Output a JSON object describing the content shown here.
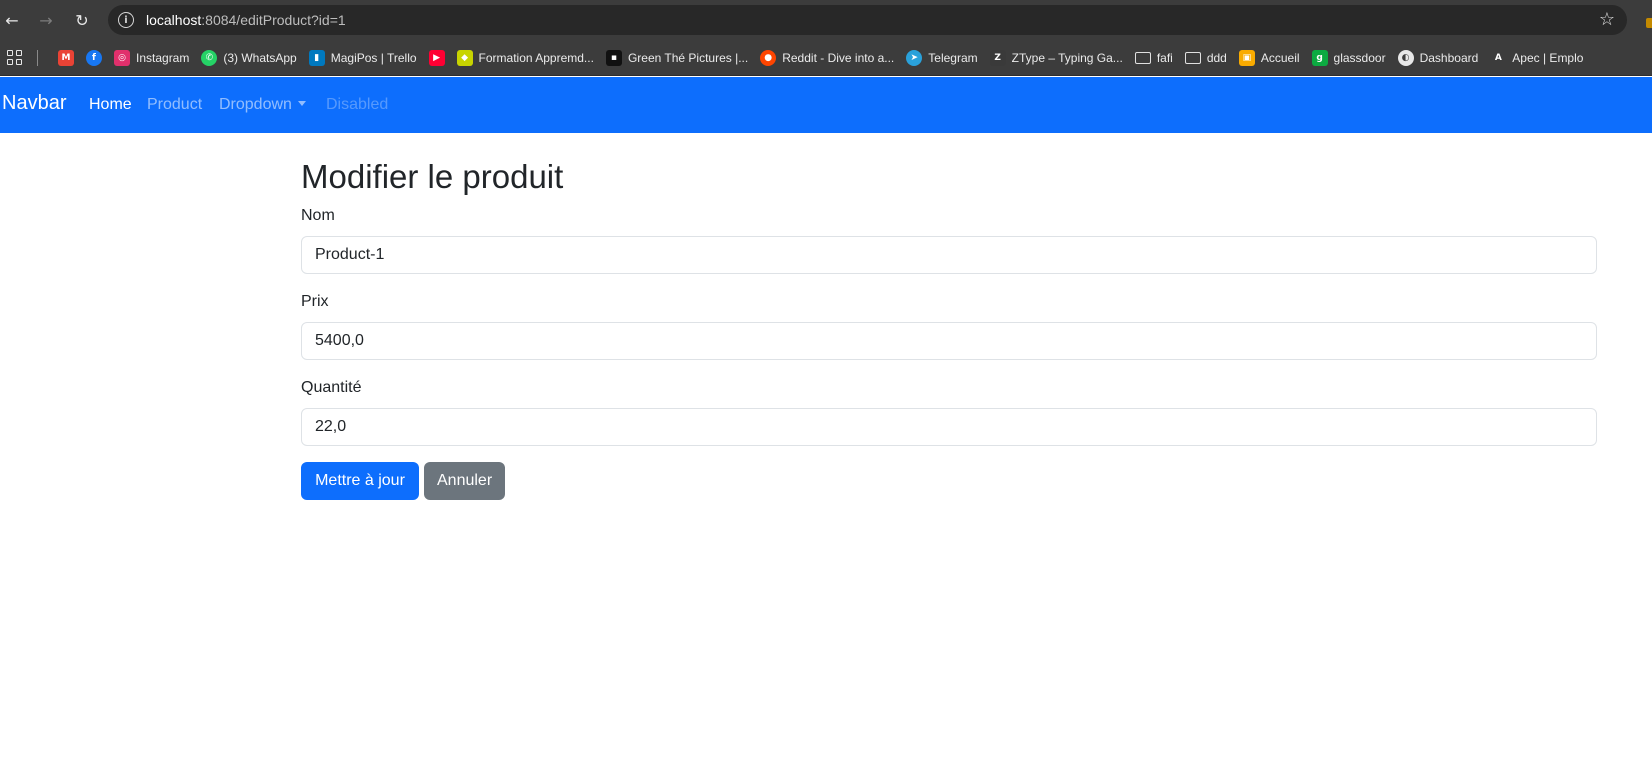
{
  "browser": {
    "url_host": "localhost",
    "url_rest": ":8084/editProduct?id=1",
    "bookmarks": [
      {
        "label": "",
        "icon": "gmail-icon",
        "color": "#ea4335"
      },
      {
        "label": "",
        "icon": "facebook-icon",
        "color": "#1877f2"
      },
      {
        "label": "Instagram",
        "icon": "instagram-icon",
        "color": "#e1306c"
      },
      {
        "label": "(3) WhatsApp",
        "icon": "whatsapp-icon",
        "color": "#25d366"
      },
      {
        "label": "MagiPos | Trello",
        "icon": "trello-icon",
        "color": "#0079bf"
      },
      {
        "label": "",
        "icon": "youtube-icon",
        "color": "#ff0033"
      },
      {
        "label": "Formation Appremd...",
        "icon": "shield-icon",
        "color": "#c8d400"
      },
      {
        "label": "Green Thé Pictures |...",
        "icon": "unsplash-icon",
        "color": "#111111"
      },
      {
        "label": "Reddit - Dive into a...",
        "icon": "reddit-icon",
        "color": "#ff4500"
      },
      {
        "label": "Telegram",
        "icon": "telegram-icon",
        "color": "#2aa1da"
      },
      {
        "label": "ZType – Typing Ga...",
        "icon": "ztype-icon",
        "color": "#3a3a3a"
      },
      {
        "label": "fafi",
        "icon": "folder-icon",
        "color": ""
      },
      {
        "label": "ddd",
        "icon": "folder-icon",
        "color": ""
      },
      {
        "label": "Accueil",
        "icon": "classroom-icon",
        "color": "#f9ab00"
      },
      {
        "label": "glassdoor",
        "icon": "glassdoor-icon",
        "color": "#0caa41"
      },
      {
        "label": "Dashboard",
        "icon": "dashboard-icon",
        "color": "#e8e8e8"
      },
      {
        "label": "Apec | Emplo",
        "icon": "apec-icon",
        "color": "#3c3c3c"
      }
    ]
  },
  "navbar": {
    "brand": "Navbar",
    "links": {
      "home": "Home",
      "product": "Product",
      "dropdown": "Dropdown",
      "disabled": "Disabled"
    },
    "color": "#0d6efd"
  },
  "form": {
    "title": "Modifier le produit",
    "fields": {
      "nom_label": "Nom",
      "nom_value": "Product-1",
      "prix_label": "Prix",
      "prix_value": "5400,0",
      "quantite_label": "Quantité",
      "quantite_value": "22,0"
    },
    "buttons": {
      "update": "Mettre à jour",
      "cancel": "Annuler"
    }
  }
}
